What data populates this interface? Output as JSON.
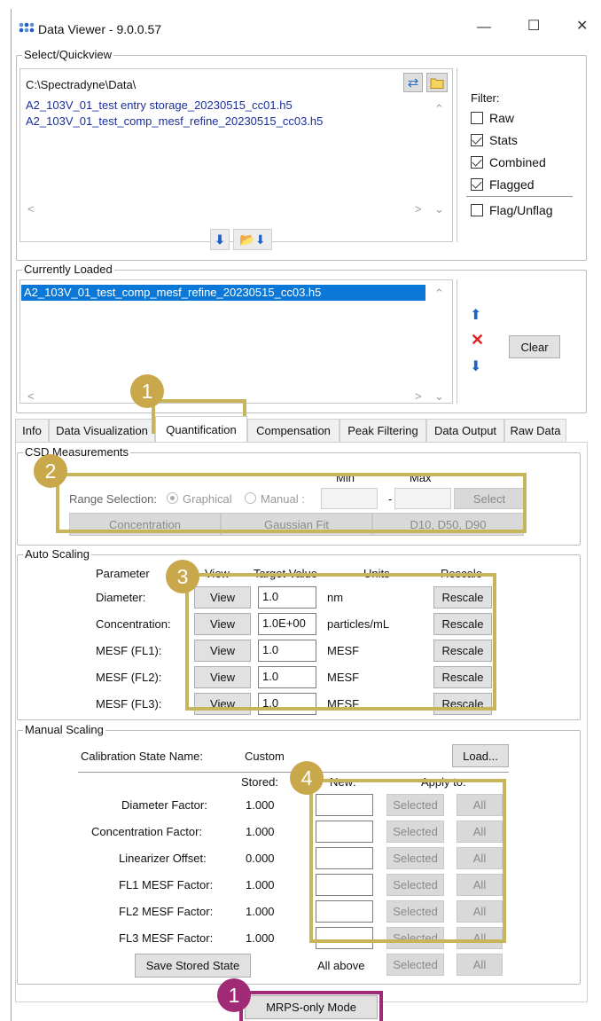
{
  "window": {
    "title": "Data Viewer - 9.0.0.57",
    "minimize": "—",
    "maximize": "☐",
    "close": "✕"
  },
  "select": {
    "legend": "Select/Quickview",
    "path": "C:\\Spectradyne\\Data\\",
    "files": [
      "A2_103V_01_test entry storage_20230515_cc01.h5",
      "A2_103V_01_test_comp_mesf_refine_20230515_cc03.h5"
    ],
    "filter_label": "Filter:",
    "filters": [
      {
        "label": "Raw",
        "checked": false
      },
      {
        "label": "Stats",
        "checked": true
      },
      {
        "label": "Combined",
        "checked": true
      },
      {
        "label": "Flagged",
        "checked": true
      }
    ],
    "flag_unflag": {
      "label": "Flag/Unflag",
      "checked": false
    }
  },
  "loaded": {
    "legend": "Currently Loaded",
    "files": [
      "A2_103V_01_test_comp_mesf_refine_20230515_cc03.h5"
    ],
    "clear": "Clear"
  },
  "tabs": [
    "Info",
    "Data Visualization",
    "Quantification",
    "Compensation",
    "Peak Filtering",
    "Data Output",
    "Raw Data"
  ],
  "active_tab": "Quantification",
  "csd": {
    "legend": "CSD Measurements",
    "min": "Min",
    "max": "Max",
    "range_selection": "Range Selection:",
    "graphical": "Graphical",
    "manual": "Manual :",
    "dash": "-",
    "select": "Select",
    "buttons": [
      "Concentration",
      "Gaussian Fit",
      "D10, D50, D90"
    ]
  },
  "auto": {
    "legend": "Auto Scaling",
    "headers": {
      "parameter": "Parameter",
      "view": "View",
      "target": "Target Value",
      "units": "Units",
      "rescale": "Rescale"
    },
    "rows": [
      {
        "param": "Diameter:",
        "view": "View",
        "target": "1.0",
        "units": "nm",
        "rescale": "Rescale"
      },
      {
        "param": "Concentration:",
        "view": "View",
        "target": "1.0E+00",
        "units": "particles/mL",
        "rescale": "Rescale"
      },
      {
        "param": "MESF (FL1):",
        "view": "View",
        "target": "1.0",
        "units": "MESF",
        "rescale": "Rescale"
      },
      {
        "param": "MESF (FL2):",
        "view": "View",
        "target": "1.0",
        "units": "MESF",
        "rescale": "Rescale"
      },
      {
        "param": "MESF (FL3):",
        "view": "View",
        "target": "1.0",
        "units": "MESF",
        "rescale": "Rescale"
      }
    ]
  },
  "manual": {
    "legend": "Manual Scaling",
    "cal_label": "Calibration State Name:",
    "cal_value": "Custom",
    "load": "Load...",
    "stored": "Stored:",
    "new": "New:",
    "apply_to": "Apply to:",
    "rows": [
      {
        "label": "Diameter Factor:",
        "stored": "1.000",
        "selected": "Selected",
        "all": "All"
      },
      {
        "label": "Concentration Factor:",
        "stored": "1.000",
        "selected": "Selected",
        "all": "All"
      },
      {
        "label": "Linearizer Offset:",
        "stored": "0.000",
        "selected": "Selected",
        "all": "All"
      },
      {
        "label": "FL1 MESF Factor:",
        "stored": "1.000",
        "selected": "Selected",
        "all": "All"
      },
      {
        "label": "FL2 MESF Factor:",
        "stored": "1.000",
        "selected": "Selected",
        "all": "All"
      },
      {
        "label": "FL3 MESF Factor:",
        "stored": "1.000",
        "selected": "Selected",
        "all": "All"
      }
    ],
    "save": "Save Stored State",
    "all_above": "All above",
    "selected": "Selected",
    "all": "All"
  },
  "mrps": "MRPS-only Mode",
  "badges": {
    "b1": "1",
    "b2": "2",
    "b3": "3",
    "b4": "4",
    "b5": "1"
  },
  "colors": {
    "gold": "#c8b45a",
    "magenta": "#a12a77",
    "link": "#1a2f9c",
    "select": "#0b78d7"
  }
}
